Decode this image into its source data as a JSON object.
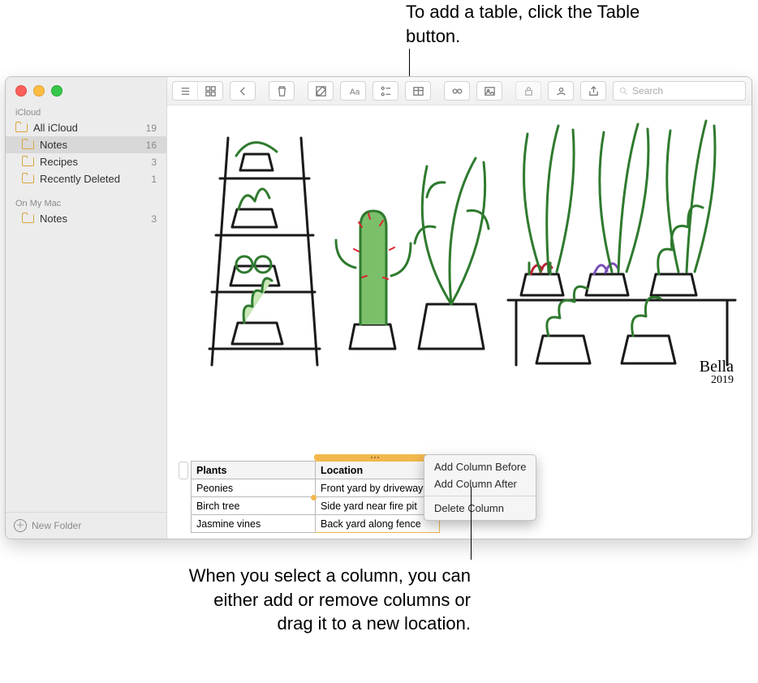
{
  "callouts": {
    "top": "To add a table, click the Table button.",
    "bottom": "When you select a column, you can either add or remove columns or drag it to a new location."
  },
  "sidebar": {
    "sections": [
      {
        "label": "iCloud",
        "items": [
          {
            "label": "All iCloud",
            "count": "19"
          },
          {
            "label": "Notes",
            "count": "16"
          },
          {
            "label": "Recipes",
            "count": "3"
          },
          {
            "label": "Recently Deleted",
            "count": "1"
          }
        ]
      },
      {
        "label": "On My Mac",
        "items": [
          {
            "label": "Notes",
            "count": "3"
          }
        ]
      }
    ],
    "footer": "New Folder"
  },
  "toolbar": {
    "search_placeholder": "Search"
  },
  "drawing": {
    "signature_name": "Bella",
    "signature_year": "2019"
  },
  "table": {
    "headers": [
      "Plants",
      "Location"
    ],
    "rows": [
      [
        "Peonies",
        "Front yard by driveway"
      ],
      [
        "Birch tree",
        "Side yard near fire pit"
      ],
      [
        "Jasmine vines",
        "Back yard along fence"
      ]
    ]
  },
  "context_menu": {
    "items": [
      "Add Column Before",
      "Add Column After"
    ],
    "after_sep": [
      "Delete Column"
    ]
  }
}
